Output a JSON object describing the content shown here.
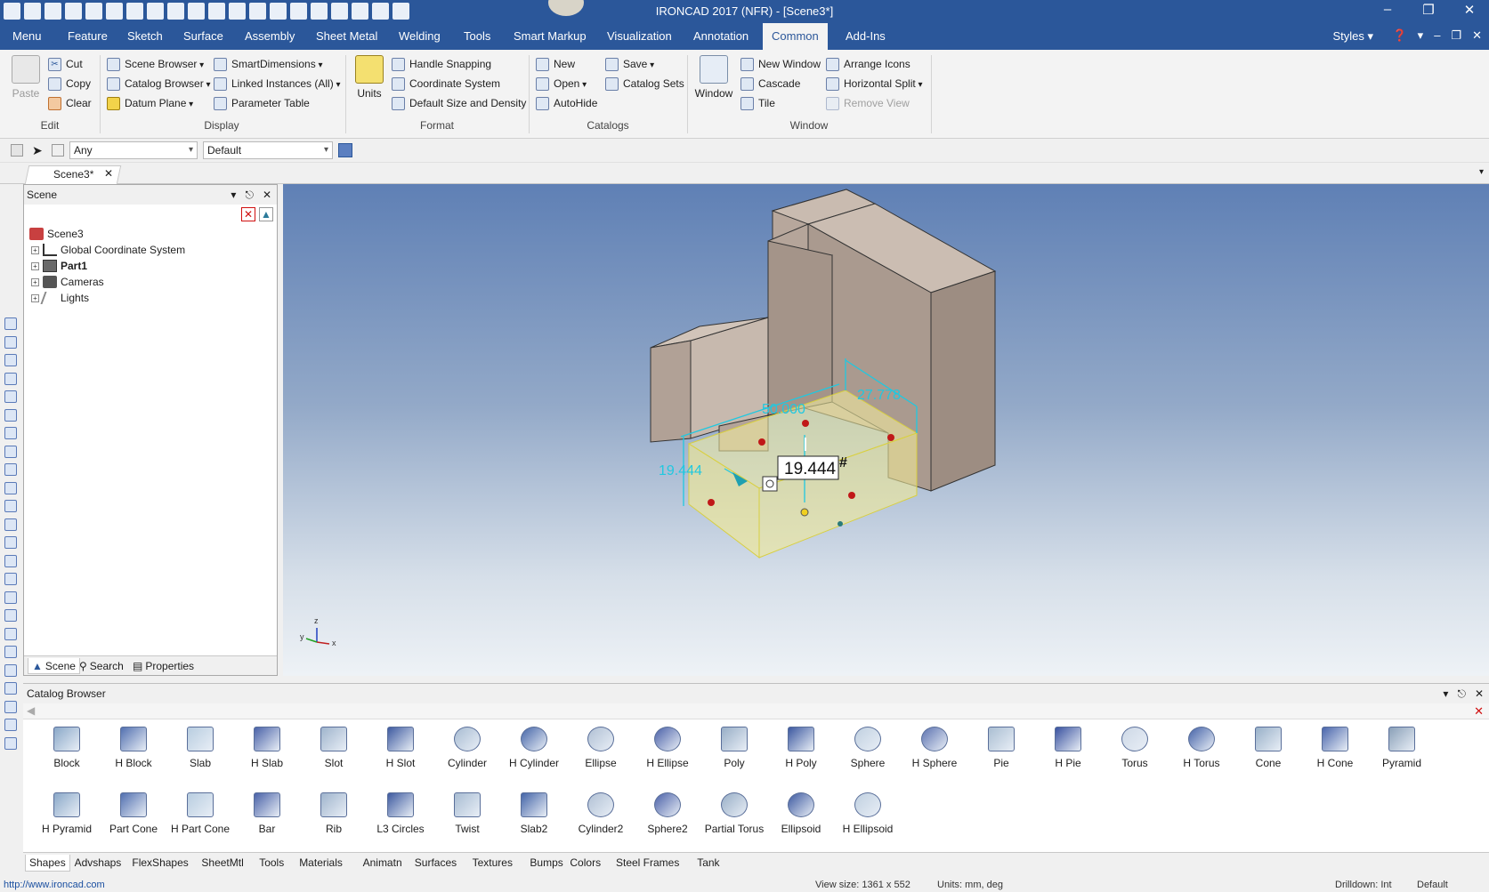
{
  "window": {
    "title": "IRONCAD 2017 (NFR) - [Scene3*]",
    "controls": [
      "–",
      "❐",
      "✕"
    ]
  },
  "quick_access": [
    "app-icon",
    "new-icon",
    "open-icon",
    "save-icon",
    "close-icon",
    "print-icon",
    "folder-icon",
    "save-all-icon",
    "pen-icon",
    "render-icon",
    "copy-icon",
    "undo-icon",
    "redo-icon",
    "lightbulb-icon",
    "smart-icon",
    "frame-icon",
    "layout-icon",
    "windows-icon",
    "help-icon",
    "mouse-icon"
  ],
  "ribbon_tabs": [
    "Menu",
    "Feature",
    "Sketch",
    "Surface",
    "Assembly",
    "Sheet Metal",
    "Welding",
    "Tools",
    "Smart Markup",
    "Visualization",
    "Annotation",
    "Common",
    "Add-Ins"
  ],
  "active_tab": "Common",
  "styles_label": "Styles",
  "ribbon": {
    "edit": {
      "paste": "Paste",
      "cut": "Cut",
      "copy": "Copy",
      "clear": "Clear",
      "group": "Edit"
    },
    "display": {
      "scene_browser": "Scene Browser",
      "catalog_browser": "Catalog Browser",
      "datum_plane": "Datum Plane",
      "smart_dimensions": "SmartDimensions",
      "linked_instances": "Linked Instances (All)",
      "parameter_table": "Parameter Table",
      "group": "Display"
    },
    "format": {
      "units": "Units",
      "handle_snapping": "Handle Snapping",
      "coordinate_system": "Coordinate System",
      "default_size": "Default Size and Density",
      "group": "Format"
    },
    "catalogs": {
      "new": "New",
      "open": "Open",
      "autohide": "AutoHide",
      "save": "Save",
      "catalog_sets": "Catalog Sets",
      "group": "Catalogs"
    },
    "window": {
      "window": "Window",
      "new_window": "New Window",
      "cascade": "Cascade",
      "tile": "Tile",
      "arrange_icons": "Arrange Icons",
      "horizontal_split": "Horizontal Split",
      "remove_view": "Remove View",
      "group": "Window"
    }
  },
  "filter_bar": {
    "filter_value": "Any",
    "style_value": "Default"
  },
  "doc_tab": {
    "label": "Scene3*"
  },
  "scene_panel": {
    "title": "Scene",
    "tree": [
      {
        "label": "Scene3",
        "bold": false
      },
      {
        "label": "Global Coordinate System",
        "bold": false
      },
      {
        "label": "Part1",
        "bold": true
      },
      {
        "label": "Cameras",
        "bold": false
      },
      {
        "label": "Lights",
        "bold": false
      }
    ],
    "tabs": [
      "Scene",
      "Search",
      "Properties"
    ]
  },
  "viewport": {
    "dimensions": {
      "length": "50.000",
      "width": "27.778",
      "height": "19.444"
    },
    "edit_value": "19.444",
    "edit_suffix": "#",
    "axes": {
      "x": "x",
      "y": "y",
      "z": "z"
    },
    "colors": {
      "body": "#c8b8ac",
      "selection": "#f6f0a0",
      "dimension": "#20c8e0",
      "handle": "#c01818"
    }
  },
  "catalog": {
    "title": "Catalog Browser",
    "row1": [
      "Block",
      "H Block",
      "Slab",
      "H Slab",
      "Slot",
      "H Slot",
      "Cylinder",
      "H Cylinder",
      "Ellipse",
      "H Ellipse",
      "Poly",
      "H Poly",
      "Sphere",
      "H Sphere",
      "Pie",
      "H Pie",
      "Torus",
      "H Torus",
      "Cone",
      "H Cone",
      "Pyramid"
    ],
    "row2": [
      "H Pyramid",
      "Part Cone",
      "H Part Cone",
      "Bar",
      "Rib",
      "L3 Circles",
      "Twist",
      "Slab2",
      "Cylinder2",
      "Sphere2",
      "Partial Torus",
      "Ellipsoid",
      "H Ellipsoid"
    ],
    "tabs": [
      "Shapes",
      "Advshaps",
      "FlexShapes",
      "SheetMtl",
      "Tools",
      "Materials",
      "Animatn",
      "Surfaces",
      "Textures",
      "Bumps",
      "Colors",
      "Steel Frames",
      "Tank"
    ],
    "active_tab": "Shapes"
  },
  "status": {
    "url": "http://www.ironcad.com",
    "view_size": "View size: 1361 x 552",
    "units": "Units: mm, deg",
    "drilldown": "Drilldown: Int",
    "default": "Default"
  }
}
